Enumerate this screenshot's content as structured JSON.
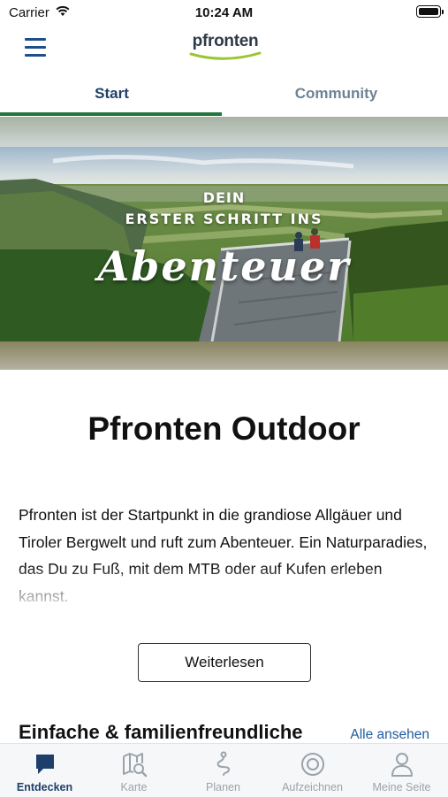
{
  "status_bar": {
    "carrier": "Carrier",
    "time": "10:24 AM"
  },
  "header": {
    "logo_text": "pfronten",
    "menu_icon": "hamburger-menu-icon"
  },
  "tabs": [
    {
      "label": "Start",
      "active": true
    },
    {
      "label": "Community",
      "active": false
    }
  ],
  "hero": {
    "line1": "DEIN",
    "line2": "ERSTER SCHRITT INS",
    "line3": "Abenteuer"
  },
  "main": {
    "title": "Pfronten Outdoor",
    "intro": "Pfronten ist der Startpunkt in die grandiose Allgäuer und Tiroler Bergwelt und ruft zum Abenteuer. Ein Naturparadies, das Du zu Fuß, mit dem MTB oder auf Kufen erleben kannst.",
    "read_more": "Weiterlesen",
    "section_title": "Einfache & familienfreundliche",
    "see_all": "Alle ansehen"
  },
  "bottom_nav": [
    {
      "label": "Entdecken",
      "icon": "speech-bubble-icon",
      "active": true
    },
    {
      "label": "Karte",
      "icon": "map-search-icon",
      "active": false
    },
    {
      "label": "Planen",
      "icon": "route-icon",
      "active": false
    },
    {
      "label": "Aufzeichnen",
      "icon": "record-icon",
      "active": false
    },
    {
      "label": "Meine Seite",
      "icon": "user-icon",
      "active": false
    }
  ],
  "colors": {
    "primary": "#1f3f6b",
    "tab_indicator": "#22763c",
    "link": "#1f5a9e",
    "inactive": "#9aa3ab"
  }
}
